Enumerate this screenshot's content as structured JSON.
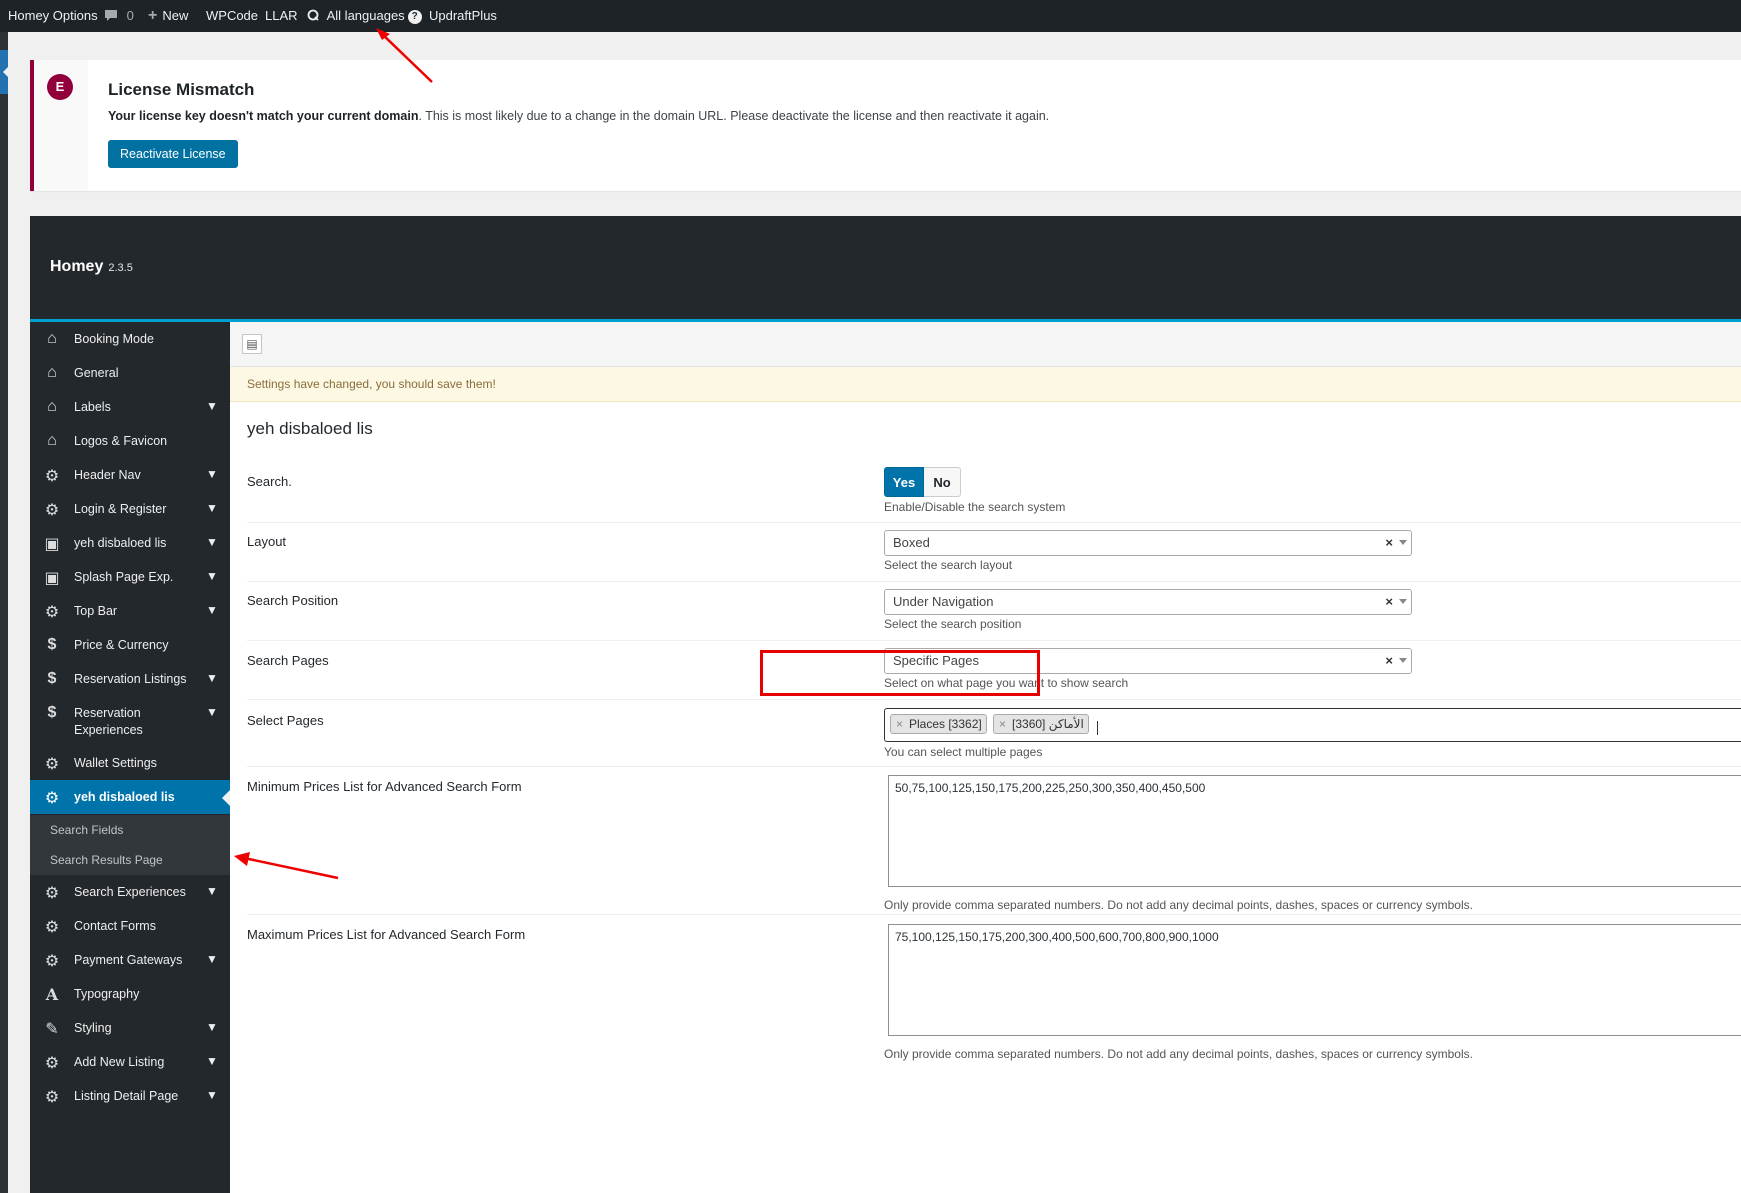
{
  "adminbar": {
    "site_name": "Homey Options",
    "comments_count": "0",
    "new_label": "New",
    "wpcode_label": "WPCode",
    "llar_label": "LLAR",
    "languages_label": "All languages",
    "languages_badge": "?",
    "updraft_label": "UpdraftPlus"
  },
  "notice": {
    "logo_text": "E",
    "title": "License Mismatch",
    "message_bold": "Your license key doesn't match your current domain",
    "message_rest": ". This is most likely due to a change in the domain URL. Please deactivate the license and then reactivate it again.",
    "button": "Reactivate License"
  },
  "panel": {
    "title": "Homey",
    "version": "2.3.5"
  },
  "menu": {
    "items": [
      {
        "label": "Booking Mode",
        "icon": "home-icon"
      },
      {
        "label": "General",
        "icon": "home-icon"
      },
      {
        "label": "Labels",
        "icon": "home-icon"
      },
      {
        "label": "Logos & Favicon",
        "icon": "home-icon"
      },
      {
        "label": "Header Nav",
        "icon": "gear-icon"
      },
      {
        "label": "Login & Register",
        "icon": "gear-icon"
      },
      {
        "label": "yeh disbaloed lis",
        "icon": "desktop-icon"
      },
      {
        "label": "Splash Page Exp.",
        "icon": "desktop-icon"
      },
      {
        "label": "Top Bar",
        "icon": "gear-icon"
      },
      {
        "label": "Price & Currency",
        "icon": "dollar-icon"
      },
      {
        "label": "Reservation Listings",
        "icon": "dollar-icon"
      },
      {
        "label": "Reservation Experiences",
        "icon": "dollar-icon"
      },
      {
        "label": "Wallet Settings",
        "icon": "gear-icon"
      },
      {
        "label": "yeh disbaloed lis",
        "icon": "gear-icon"
      },
      {
        "label": "Search Experiences",
        "icon": "gear-icon"
      },
      {
        "label": "Contact Forms",
        "icon": "gear-icon"
      },
      {
        "label": "Payment Gateways",
        "icon": "gear-icon"
      },
      {
        "label": "Typography",
        "icon": "font-icon"
      },
      {
        "label": "Styling",
        "icon": "brush-icon"
      },
      {
        "label": "Add New Listing",
        "icon": "gear-icon"
      },
      {
        "label": "Listing Detail Page",
        "icon": "gear-icon"
      }
    ],
    "subitems": [
      "Search Fields",
      "Search Results Page"
    ]
  },
  "content": {
    "save_notice": "Settings have changed, you should save them!",
    "section_title": "yeh disbaloed lis",
    "search": {
      "label": "Search.",
      "yes": "Yes",
      "no": "No",
      "desc": "Enable/Disable the search system"
    },
    "layout": {
      "label": "Layout",
      "value": "Boxed",
      "desc": "Select the search layout"
    },
    "position": {
      "label": "Search Position",
      "value": "Under Navigation",
      "desc": "Select the search position"
    },
    "pages": {
      "label": "Search Pages",
      "value": "Specific Pages",
      "desc": "Select on what page you want to show search"
    },
    "select_pages": {
      "label": "Select Pages",
      "chips": [
        "Places [3362]",
        "الأماكن [3360]"
      ],
      "desc": "You can select multiple pages"
    },
    "min_prices": {
      "label": "Minimum Prices List for Advanced Search Form",
      "value": "50,75,100,125,150,175,200,225,250,300,350,400,450,500",
      "desc": "Only provide comma separated numbers. Do not add any decimal points, dashes, spaces or currency symbols."
    },
    "max_prices": {
      "label": "Maximum Prices List for Advanced Search Form",
      "value": "75,100,125,150,175,200,300,400,500,600,700,800,900,1000",
      "desc": "Only provide comma separated numbers. Do not add any decimal points, dashes, spaces or currency symbols."
    },
    "clear_symbol": "×"
  }
}
